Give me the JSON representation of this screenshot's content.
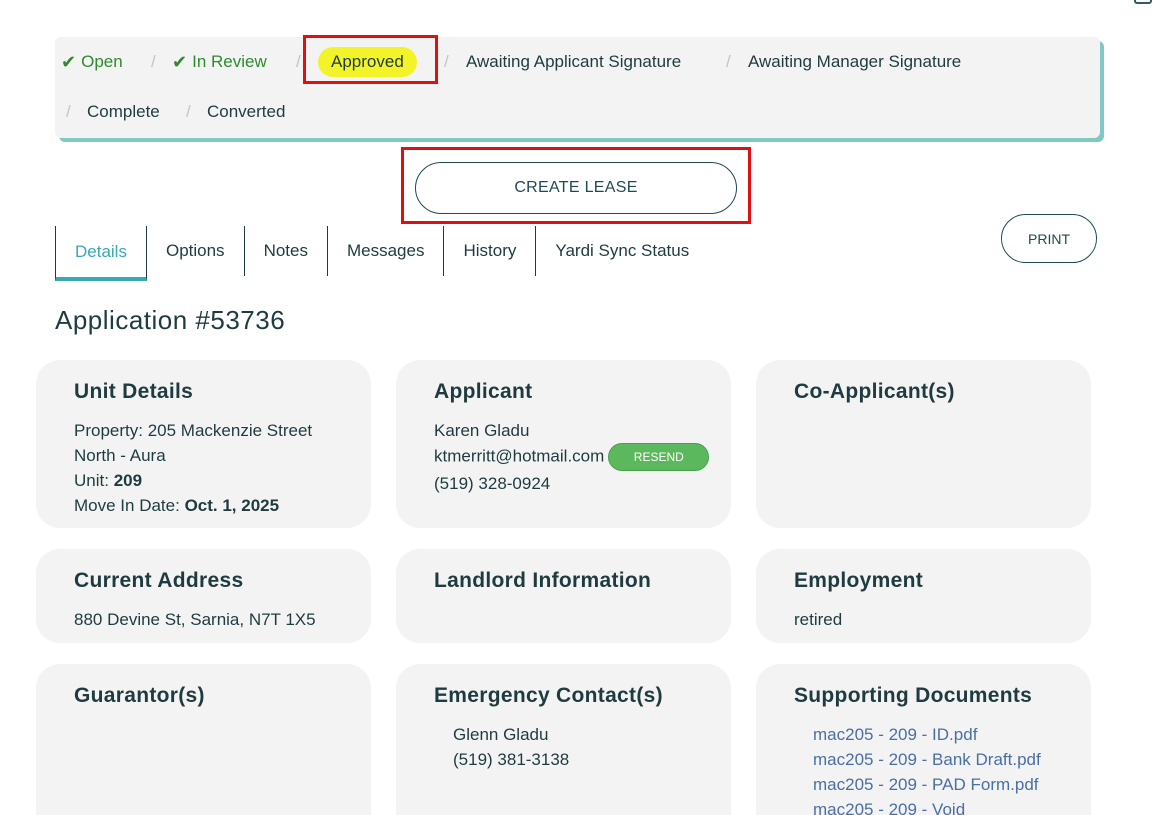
{
  "steps": [
    {
      "label": "Open",
      "state": "done"
    },
    {
      "label": "In Review",
      "state": "done"
    },
    {
      "label": "Approved",
      "state": "current"
    },
    {
      "label": "Awaiting Applicant Signature",
      "state": "pending"
    },
    {
      "label": "Awaiting Manager Signature",
      "state": "pending"
    },
    {
      "label": "Complete",
      "state": "pending"
    },
    {
      "label": "Converted",
      "state": "pending"
    }
  ],
  "separator": "/",
  "actions": {
    "create_lease": "CREATE LEASE",
    "print": "PRINT"
  },
  "tabs": [
    "Details",
    "Options",
    "Notes",
    "Messages",
    "History",
    "Yardi Sync Status"
  ],
  "active_tab": "Details",
  "application": {
    "title": "Application #53736"
  },
  "unit_details": {
    "title": "Unit Details",
    "property_label": "Property:",
    "property": "205 Mackenzie Street North - Aura",
    "unit_label": "Unit:",
    "unit": "209",
    "move_in_label": "Move In Date:",
    "move_in": "Oct. 1, 2025"
  },
  "applicant": {
    "title": "Applicant",
    "name": "Karen Gladu",
    "email": "ktmerritt@hotmail.com",
    "resend_label": "RESEND",
    "phone": "(519) 328-0924"
  },
  "co_applicants": {
    "title": "Co-Applicant(s)"
  },
  "current_address": {
    "title": "Current Address",
    "address": "880 Devine St, Sarnia, N7T 1X5"
  },
  "landlord": {
    "title": "Landlord Information"
  },
  "employment": {
    "title": "Employment",
    "value": "retired"
  },
  "guarantors": {
    "title": "Guarantor(s)"
  },
  "emergency_contacts": {
    "title": "Emergency Contact(s)",
    "name": "Glenn Gladu",
    "phone": "(519) 381-3138"
  },
  "supporting_documents": {
    "title": "Supporting Documents",
    "files": [
      "mac205 - 209 - ID.pdf",
      "mac205 - 209 - Bank Draft.pdf",
      "mac205 - 209 - PAD Form.pdf",
      "mac205 - 209 - Void"
    ]
  },
  "colors": {
    "accent": "#3aa9b2",
    "done": "#2e8b2e",
    "current_highlight": "#f3f32a",
    "link": "#4a6fa5",
    "resend": "#5cb85c",
    "annotation": "#dd1111"
  }
}
